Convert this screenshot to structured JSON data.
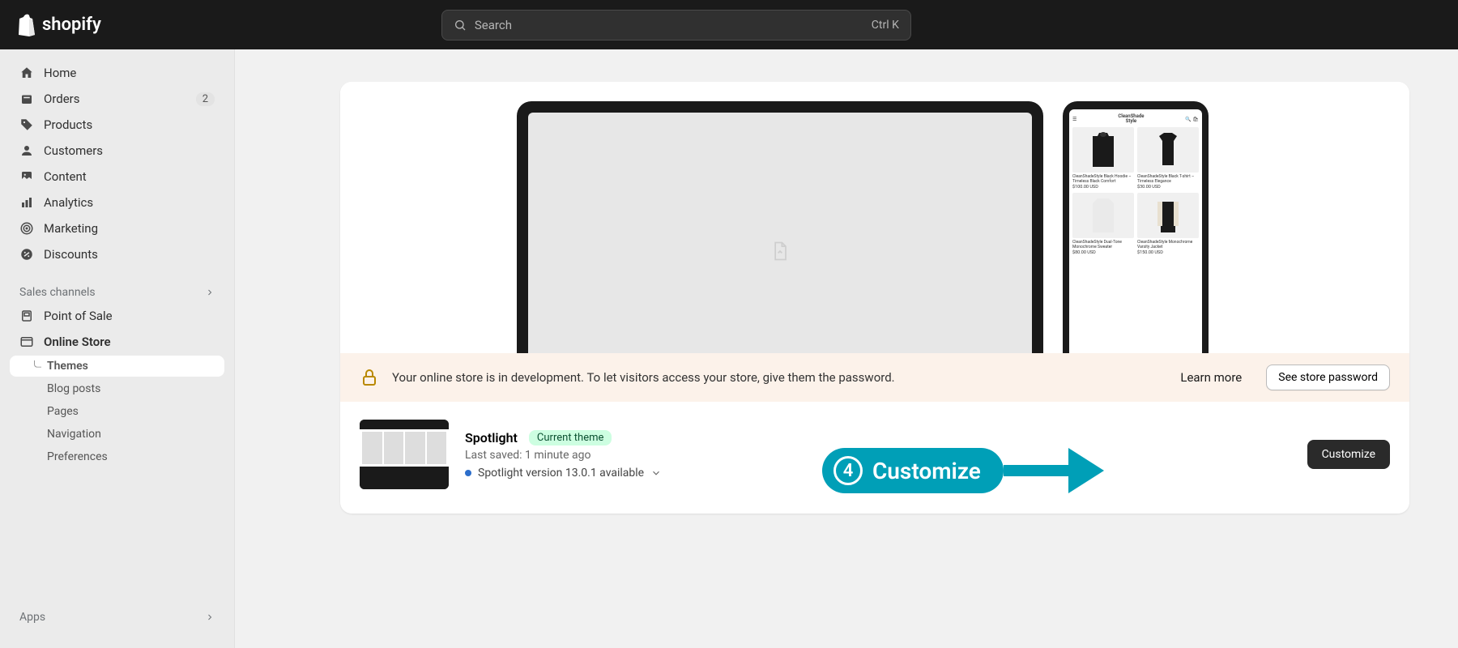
{
  "topbar": {
    "logo": "shopify",
    "search_placeholder": "Search",
    "search_shortcut": "Ctrl K"
  },
  "sidebar": {
    "items": [
      {
        "label": "Home"
      },
      {
        "label": "Orders",
        "badge": "2"
      },
      {
        "label": "Products"
      },
      {
        "label": "Customers"
      },
      {
        "label": "Content"
      },
      {
        "label": "Analytics"
      },
      {
        "label": "Marketing"
      },
      {
        "label": "Discounts"
      }
    ],
    "channels_label": "Sales channels",
    "channels": [
      {
        "label": "Point of Sale"
      },
      {
        "label": "Online Store"
      }
    ],
    "online_store_sub": [
      {
        "label": "Themes",
        "active": true
      },
      {
        "label": "Blog posts"
      },
      {
        "label": "Pages"
      },
      {
        "label": "Navigation"
      },
      {
        "label": "Preferences"
      }
    ],
    "apps_label": "Apps"
  },
  "banner": {
    "text": "Your online store is in development. To let visitors access your store, give them the password.",
    "learn_more": "Learn more",
    "password_btn": "See store password"
  },
  "theme": {
    "name": "Spotlight",
    "badge": "Current theme",
    "saved": "Last saved: 1 minute ago",
    "version": "Spotlight version 13.0.1 available",
    "customize_btn": "Customize"
  },
  "mobile_preview": {
    "title_line1": "CleanShade",
    "title_line2": "Style",
    "products": [
      {
        "name": "CleanShadeStyle Black Hoodie – Timeless Black Comfort",
        "price": "$100.00 USD"
      },
      {
        "name": "CleanShadeStyle Black T-shirt – Timeless Elegance",
        "price": "$30.00 USD"
      },
      {
        "name": "CleanShadeStyle Dual-Tone Monochrome Sweater",
        "price": "$80.00 USD"
      },
      {
        "name": "CleanShadeStyle Monochrome Varsity Jacket",
        "price": "$150.00 USD"
      }
    ]
  },
  "annotation": {
    "number": "4",
    "label": "Customize"
  }
}
